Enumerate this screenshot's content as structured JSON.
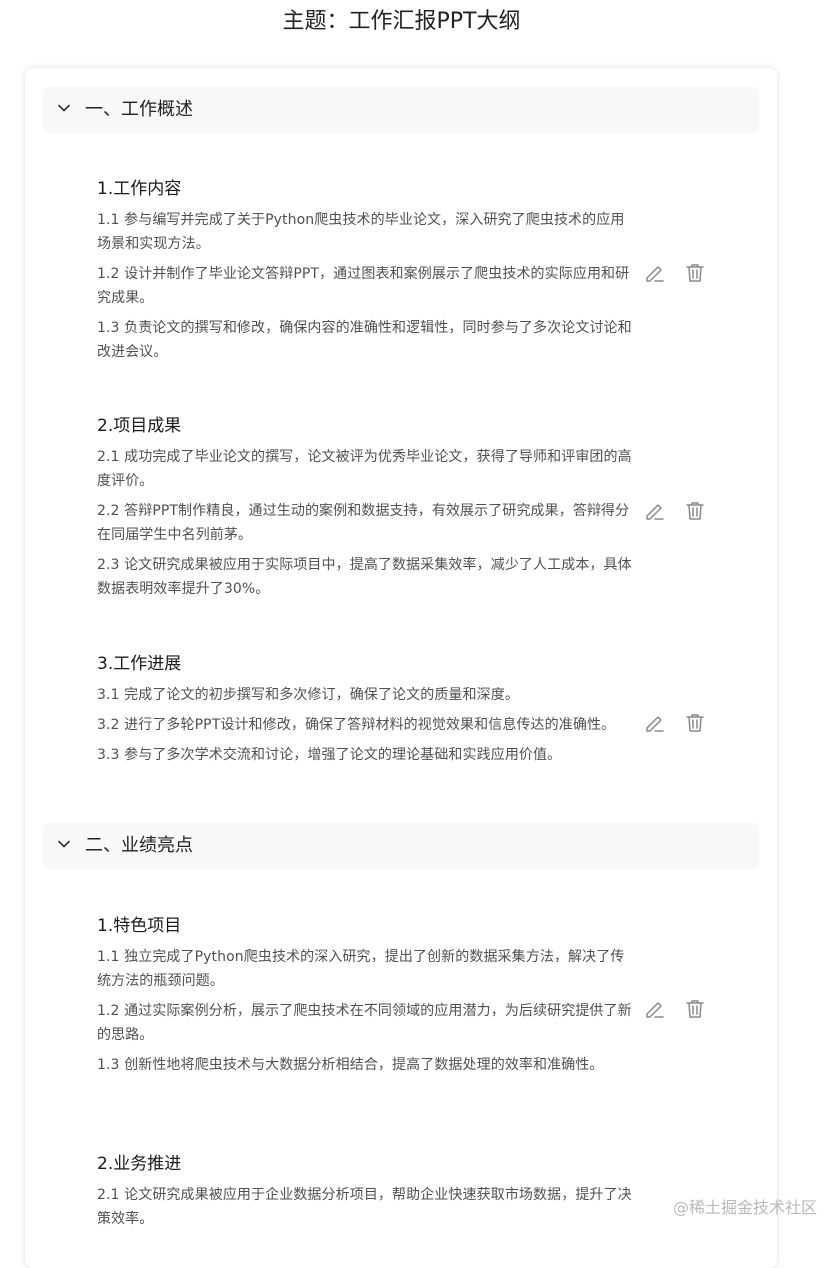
{
  "page_title": "主题：工作汇报PPT大纲",
  "sections": [
    {
      "title": "一、工作概述",
      "items": [
        {
          "title": "1.工作内容",
          "lines": [
            "1.1 参与编写并完成了关于Python爬虫技术的毕业论文，深入研究了爬虫技术的应用场景和实现方法。",
            "1.2 设计并制作了毕业论文答辩PPT，通过图表和案例展示了爬虫技术的实际应用和研究成果。",
            "1.3 负责论文的撰写和修改，确保内容的准确性和逻辑性，同时参与了多次论文讨论和改进会议。"
          ]
        },
        {
          "title": "2.项目成果",
          "lines": [
            "2.1 成功完成了毕业论文的撰写，论文被评为优秀毕业论文，获得了导师和评审团的高度评价。",
            "2.2 答辩PPT制作精良，通过生动的案例和数据支持，有效展示了研究成果，答辩得分在同届学生中名列前茅。",
            "2.3 论文研究成果被应用于实际项目中，提高了数据采集效率，减少了人工成本，具体数据表明效率提升了30%。"
          ]
        },
        {
          "title": "3.工作进展",
          "lines": [
            "3.1 完成了论文的初步撰写和多次修订，确保了论文的质量和深度。",
            "3.2 进行了多轮PPT设计和修改，确保了答辩材料的视觉效果和信息传达的准确性。",
            "3.3 参与了多次学术交流和讨论，增强了论文的理论基础和实践应用价值。"
          ]
        }
      ]
    },
    {
      "title": "二、业绩亮点",
      "items": [
        {
          "title": "1.特色项目",
          "lines": [
            "1.1 独立完成了Python爬虫技术的深入研究，提出了创新的数据采集方法，解决了传统方法的瓶颈问题。",
            "1.2 通过实际案例分析，展示了爬虫技术在不同领域的应用潜力，为后续研究提供了新的思路。",
            "1.3 创新性地将爬虫技术与大数据分析相结合，提高了数据处理的效率和准确性。"
          ]
        },
        {
          "title": "2.业务推进",
          "lines": [
            "2.1 论文研究成果被应用于企业数据分析项目，帮助企业快速获取市场数据，提升了决策效率。"
          ]
        }
      ]
    }
  ],
  "watermark": "@稀土掘金技术社区",
  "icons": {
    "collapse": "chevron-down-icon",
    "edit": "pencil-icon",
    "delete": "trash-icon"
  },
  "colors": {
    "header_bg": "#f7f8fa",
    "text": "#505050",
    "icon": "#8a8a8a"
  }
}
